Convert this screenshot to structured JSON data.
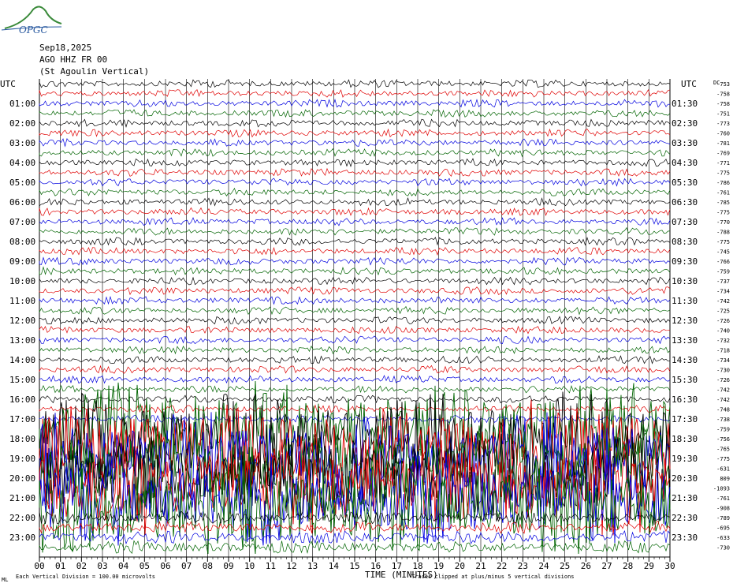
{
  "header": {
    "logo_text": "OPGC",
    "date": "Sep18,2025",
    "station": "AGO HHZ FR 00",
    "station_name": "(St Agoulin Vertical)"
  },
  "chart_data": {
    "type": "line",
    "title": "AGO HHZ FR 00",
    "left_axis_title": "UTC",
    "right_axis_title": "UTC",
    "xlabel": "TIME (MINUTES)",
    "x_ticks": [
      "00",
      "01",
      "02",
      "03",
      "04",
      "05",
      "06",
      "07",
      "08",
      "09",
      "10",
      "11",
      "12",
      "13",
      "14",
      "15",
      "16",
      "17",
      "18",
      "19",
      "20",
      "21",
      "22",
      "23",
      "24",
      "25",
      "26",
      "27",
      "28",
      "29",
      "30"
    ],
    "xlim": [
      0,
      30
    ],
    "left_hour_labels": [
      "01:00",
      "02:00",
      "03:00",
      "04:00",
      "05:00",
      "06:00",
      "07:00",
      "08:00",
      "09:00",
      "10:00",
      "11:00",
      "12:00",
      "13:00",
      "14:00",
      "15:00",
      "16:00",
      "17:00",
      "18:00",
      "19:00",
      "20:00",
      "21:00",
      "22:00",
      "23:00"
    ],
    "right_hour_labels": [
      "01:30",
      "02:30",
      "03:30",
      "04:30",
      "05:30",
      "06:30",
      "07:30",
      "08:30",
      "09:30",
      "10:30",
      "11:30",
      "12:30",
      "13:30",
      "14:30",
      "15:30",
      "16:30",
      "17:30",
      "18:30",
      "19:30",
      "20:30",
      "21:30",
      "22:30",
      "23:30"
    ],
    "trace_offsets": [
      "-753",
      "-758",
      "-758",
      "-751",
      "-773",
      "-760",
      "-781",
      "-769",
      "-771",
      "-775",
      "-786",
      "-761",
      "-785",
      "-775",
      "-770",
      "-788",
      "-775",
      "-745",
      "-766",
      "-759",
      "-737",
      "-734",
      "-742",
      "-725",
      "-726",
      "-740",
      "-732",
      "-718",
      "-734",
      "-730",
      "-726",
      "-742",
      "-742",
      "-748",
      "-738",
      "-759",
      "-756",
      "-765",
      "-775",
      "-631",
      "809",
      "-1093",
      "-761",
      "-908",
      "-789",
      "-695",
      "-633",
      "-730"
    ],
    "right_top_unit": "DC",
    "trace_colors": [
      "#000000",
      "#e00000",
      "#0000e0",
      "#006400"
    ],
    "footer_left": "Each Vertical Division = 100.00 microvolts",
    "footer_right": "Traces clipped at plus/minus 5 vertical divisions",
    "footer_mark": "ML"
  }
}
